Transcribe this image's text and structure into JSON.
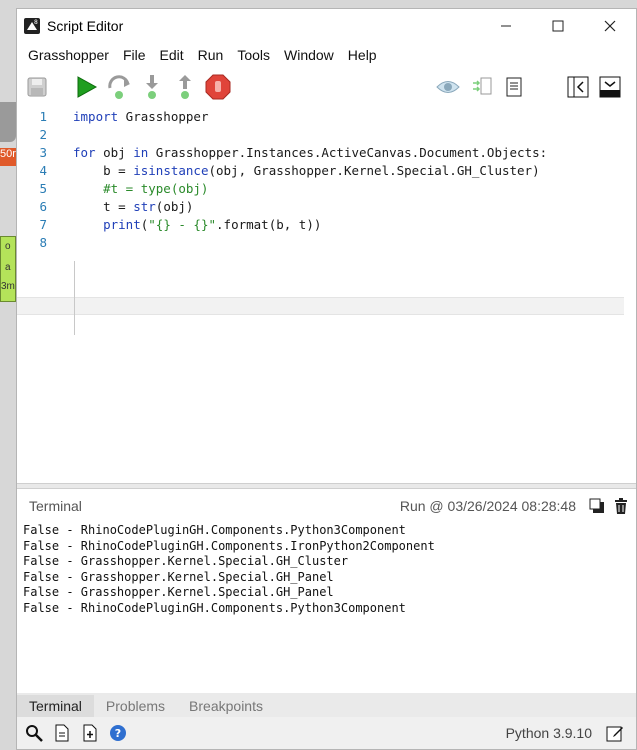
{
  "window": {
    "title": "Script Editor"
  },
  "menu": [
    "Grasshopper",
    "File",
    "Edit",
    "Run",
    "Tools",
    "Window",
    "Help"
  ],
  "background": {
    "orange_node_text": "50r",
    "green_node_lines": [
      "o",
      "a",
      "3m"
    ]
  },
  "editor": {
    "line_numbers": [
      "1",
      "2",
      "3",
      "4",
      "5",
      "6",
      "7",
      "8"
    ],
    "lines": [
      [
        {
          "t": "import",
          "c": "kw"
        },
        {
          "t": " Grasshopper",
          "c": ""
        }
      ],
      [],
      [
        {
          "t": "for",
          "c": "kw"
        },
        {
          "t": " obj ",
          "c": ""
        },
        {
          "t": "in",
          "c": "kw"
        },
        {
          "t": " Grasshopper.Instances.ActiveCanvas.Document.Objects:",
          "c": ""
        }
      ],
      [
        {
          "t": "    b = ",
          "c": ""
        },
        {
          "t": "isinstance",
          "c": "fn"
        },
        {
          "t": "(obj, Grasshopper.Kernel.Special.GH_Cluster)",
          "c": ""
        }
      ],
      [
        {
          "t": "    #t = type(obj)",
          "c": "cm"
        }
      ],
      [
        {
          "t": "    t = ",
          "c": ""
        },
        {
          "t": "str",
          "c": "fn"
        },
        {
          "t": "(obj)",
          "c": ""
        }
      ],
      [
        {
          "t": "    ",
          "c": ""
        },
        {
          "t": "print",
          "c": "fn"
        },
        {
          "t": "(",
          "c": ""
        },
        {
          "t": "\"{} - {}\"",
          "c": "str"
        },
        {
          "t": ".format(b, t))",
          "c": ""
        }
      ],
      []
    ]
  },
  "terminal": {
    "title": "Terminal",
    "run_stamp": "Run @ 03/26/2024 08:28:48",
    "lines": [
      "False - RhinoCodePluginGH.Components.Python3Component",
      "False - RhinoCodePluginGH.Components.IronPython2Component",
      "False - Grasshopper.Kernel.Special.GH_Cluster",
      "False - Grasshopper.Kernel.Special.GH_Panel",
      "False - Grasshopper.Kernel.Special.GH_Panel",
      "False - RhinoCodePluginGH.Components.Python3Component"
    ]
  },
  "tabs": [
    "Terminal",
    "Problems",
    "Breakpoints"
  ],
  "status": {
    "python_version": "Python 3.9.10"
  },
  "colors": {
    "run_green": "#1f9e1f",
    "stop_red": "#e0443a",
    "keyword_blue": "#1f3fb8",
    "line_number": "#2b7db5"
  }
}
